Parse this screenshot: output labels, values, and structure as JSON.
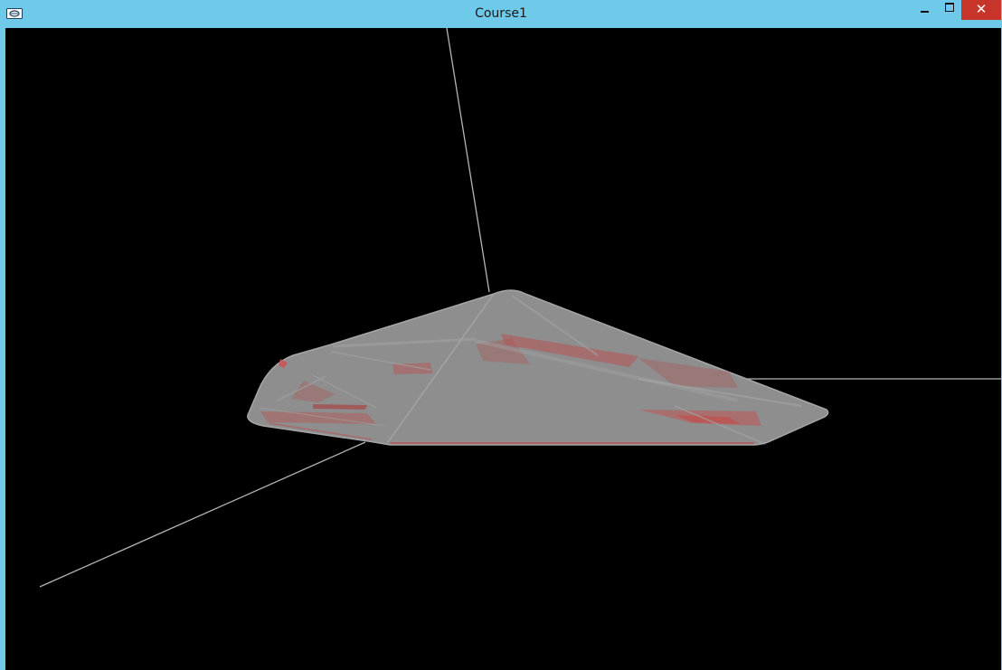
{
  "window": {
    "title": "Course1",
    "title_bar_color": "#6ecae8",
    "close_button_color": "#c7342a",
    "icons": [
      "app-icon",
      "minimize-icon",
      "maximize-icon",
      "close-icon"
    ]
  },
  "scene": {
    "background_color": "#000000",
    "axis_color": "#b5b5b5",
    "mesh_color": "#8e8e8e",
    "mesh_edge_color": "#a8a8a8",
    "backface_color": "#b85454"
  }
}
